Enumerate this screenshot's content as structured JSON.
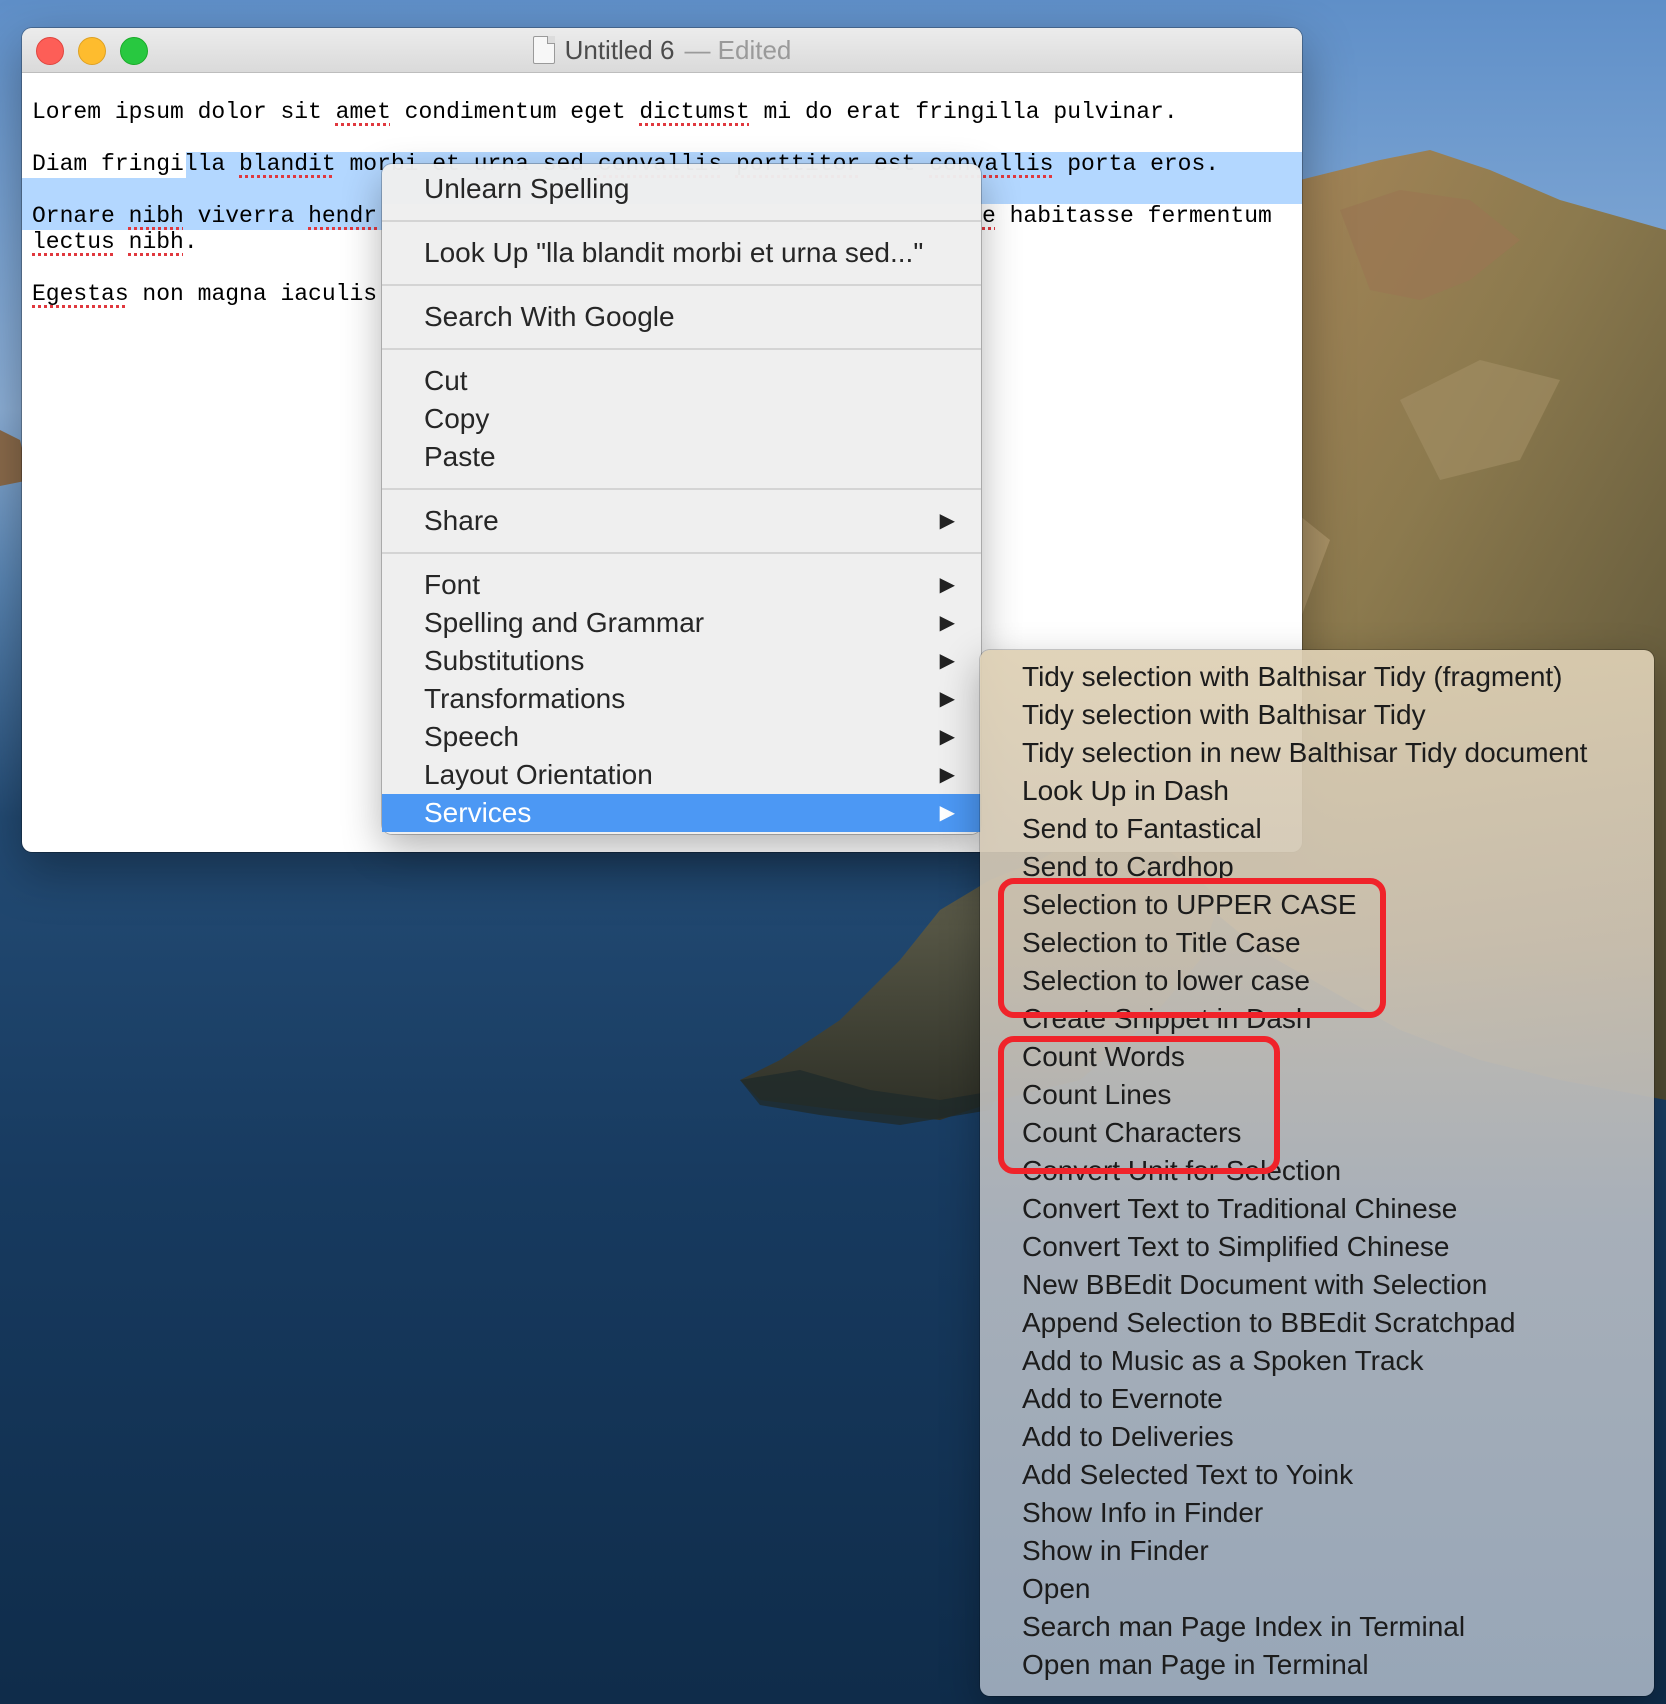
{
  "window": {
    "title": "Untitled 6",
    "status": "— Edited"
  },
  "document": {
    "line1": [
      {
        "t": "Lorem ipsum dolor sit "
      },
      {
        "t": "amet",
        "m": true
      },
      {
        "t": " condimentum eget "
      },
      {
        "t": "dictumst",
        "m": true
      },
      {
        "t": " mi do erat fringilla pulvinar."
      }
    ],
    "line2": [
      {
        "t": "Diam fringilla "
      },
      {
        "t": "blandit",
        "m": true
      },
      {
        "t": " morbi et urna sed "
      },
      {
        "t": "convallis",
        "m": true
      },
      {
        "t": " "
      },
      {
        "t": "porttitor",
        "m": true
      },
      {
        "t": " est "
      },
      {
        "t": "convallis",
        "m": true
      },
      {
        "t": " porta eros."
      }
    ],
    "line3": [
      {
        "t": "Ornare "
      },
      {
        "t": "nibh",
        "m": true
      },
      {
        "t": " viverra "
      },
      {
        "t": "hendr",
        "m": true
      }
    ],
    "line3_tail": [
      {
        "t": "e",
        "m": true
      },
      {
        "t": " habitasse fermentum"
      }
    ],
    "line4": [
      {
        "t": "lectus",
        "m": true
      },
      {
        "t": " "
      },
      {
        "t": "nibh",
        "m": true
      },
      {
        "t": "."
      }
    ],
    "line5": [
      {
        "t": "Egestas",
        "m": true
      },
      {
        "t": " non magna iaculis"
      }
    ]
  },
  "context_menu": {
    "groups": [
      [
        {
          "label": "Unlearn Spelling"
        }
      ],
      [
        {
          "label": "Look Up \"lla blandit morbi et urna sed...\""
        }
      ],
      [
        {
          "label": "Search With Google"
        }
      ],
      [
        {
          "label": "Cut"
        },
        {
          "label": "Copy"
        },
        {
          "label": "Paste"
        }
      ],
      [
        {
          "label": "Share",
          "submenu": true
        }
      ],
      [
        {
          "label": "Font",
          "submenu": true
        },
        {
          "label": "Spelling and Grammar",
          "submenu": true
        },
        {
          "label": "Substitutions",
          "submenu": true
        },
        {
          "label": "Transformations",
          "submenu": true
        },
        {
          "label": "Speech",
          "submenu": true
        },
        {
          "label": "Layout Orientation",
          "submenu": true
        },
        {
          "label": "Services",
          "submenu": true,
          "highlighted": true
        }
      ]
    ],
    "submenu_arrow": "▶"
  },
  "services_menu": {
    "items": [
      "Tidy selection with Balthisar Tidy (fragment)",
      "Tidy selection with Balthisar Tidy",
      "Tidy selection in new Balthisar Tidy document",
      "Look Up in Dash",
      "Send to Fantastical",
      "Send to Cardhop",
      "Selection to UPPER CASE",
      "Selection to Title Case",
      "Selection to lower case",
      "Create Snippet in Dash",
      "Count Words",
      "Count Lines",
      "Count Characters",
      "Convert Unit for Selection",
      "Convert Text to Traditional Chinese",
      "Convert Text to Simplified Chinese",
      "New BBEdit Document with Selection",
      "Append Selection to BBEdit Scratchpad",
      "Add to Music as a Spoken Track",
      "Add to Evernote",
      "Add to Deliveries",
      "Add Selected Text to Yoink",
      "Show Info in Finder",
      "Show in Finder",
      "Open",
      "Search man Page Index in Terminal",
      "Open man Page in Terminal"
    ]
  },
  "colors": {
    "selection": "#b3d7ff",
    "highlight": "#4c98f4",
    "annotation": "#f0232a",
    "misspelling": "#e0383e"
  }
}
